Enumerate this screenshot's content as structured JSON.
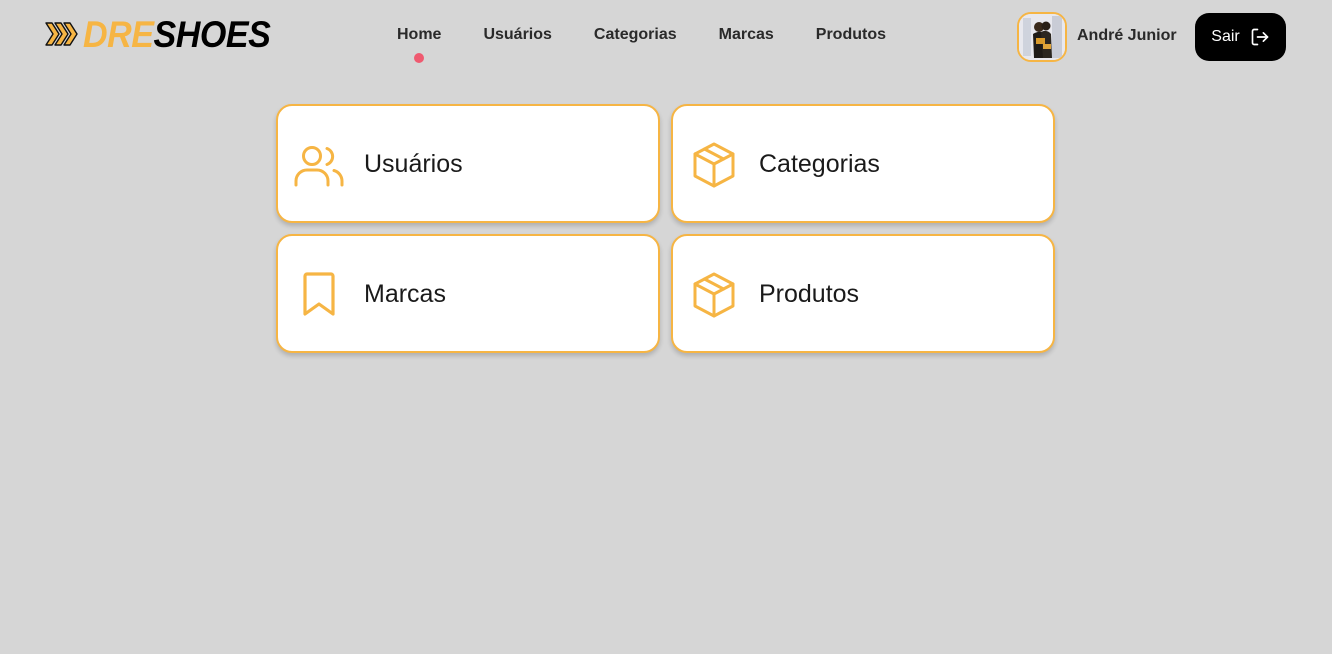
{
  "brand": {
    "part1": "DRE",
    "part2": "SHOES",
    "accent": "#f6b544"
  },
  "nav": {
    "items": [
      {
        "label": "Home",
        "active": true
      },
      {
        "label": "Usuários"
      },
      {
        "label": "Categorias"
      },
      {
        "label": "Marcas"
      },
      {
        "label": "Produtos"
      }
    ],
    "active_indicator_color": "#ef5a70"
  },
  "user": {
    "name": "André Junior",
    "avatar_icon": "user-photo"
  },
  "logout": {
    "label": "Sair",
    "icon": "logout-icon"
  },
  "cards": [
    {
      "label": "Usuários",
      "icon": "users-icon"
    },
    {
      "label": "Categorias",
      "icon": "box-icon"
    },
    {
      "label": "Marcas",
      "icon": "bookmark-icon"
    },
    {
      "label": "Produtos",
      "icon": "box-icon"
    }
  ]
}
